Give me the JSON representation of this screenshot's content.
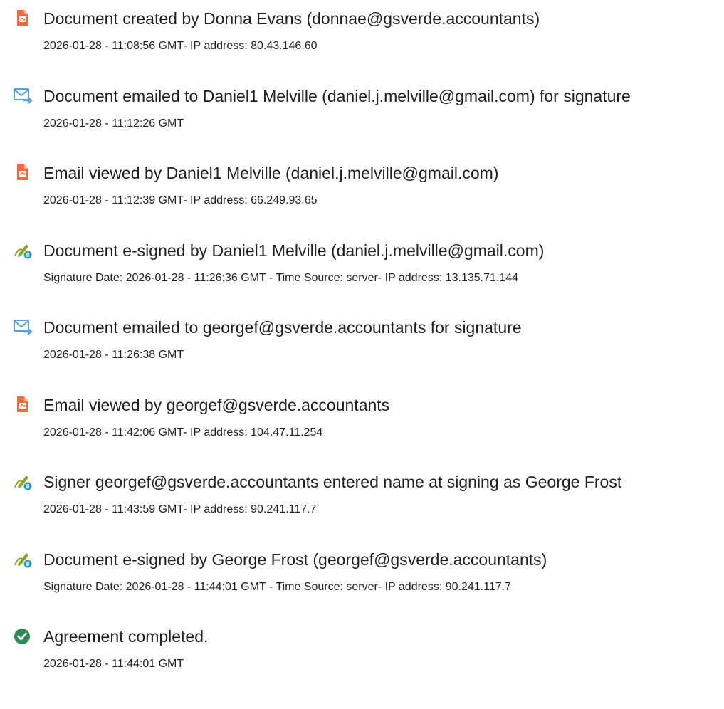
{
  "events": [
    {
      "icon": "document-pdf-icon",
      "title": "Document created by Donna Evans (donnae@gsverde.accountants)",
      "detail": "2026-01-28 - 11:08:56 GMT- IP address: 80.43.146.60"
    },
    {
      "icon": "email-sent-icon",
      "title": "Document emailed to Daniel1 Melville (daniel.j.melville@gmail.com) for signature",
      "detail": "2026-01-28 - 11:12:26 GMT"
    },
    {
      "icon": "document-pdf-icon",
      "title": "Email viewed by Daniel1 Melville (daniel.j.melville@gmail.com)",
      "detail": "2026-01-28 - 11:12:39 GMT- IP address: 66.249.93.65"
    },
    {
      "icon": "e-sign-pen-icon",
      "title": "Document e-signed by Daniel1 Melville (daniel.j.melville@gmail.com)",
      "detail": "Signature Date: 2026-01-28 - 11:26:36 GMT - Time Source: server- IP address: 13.135.71.144"
    },
    {
      "icon": "email-sent-icon",
      "title": "Document emailed to georgef@gsverde.accountants for signature",
      "detail": "2026-01-28 - 11:26:38 GMT"
    },
    {
      "icon": "document-pdf-icon",
      "title": "Email viewed by georgef@gsverde.accountants",
      "detail": "2026-01-28 - 11:42:06 GMT- IP address: 104.47.11.254"
    },
    {
      "icon": "e-sign-pen-icon",
      "title": "Signer georgef@gsverde.accountants entered name at signing as George Frost",
      "detail": "2026-01-28 - 11:43:59 GMT- IP address: 90.241.117.7"
    },
    {
      "icon": "e-sign-pen-icon",
      "title": "Document e-signed by George Frost (georgef@gsverde.accountants)",
      "detail": "Signature Date: 2026-01-28 - 11:44:01 GMT - Time Source: server- IP address: 90.241.117.7"
    },
    {
      "icon": "check-circle-icon",
      "title": "Agreement completed.",
      "detail": "2026-01-28 - 11:44:01 GMT"
    }
  ],
  "colors": {
    "document_icon": "#ee6b3b",
    "email_icon": "#5a9fd6",
    "sign_pen_icon": "#8aa428",
    "sign_badge": "#2f9bb3",
    "check_icon": "#2e8b57"
  }
}
